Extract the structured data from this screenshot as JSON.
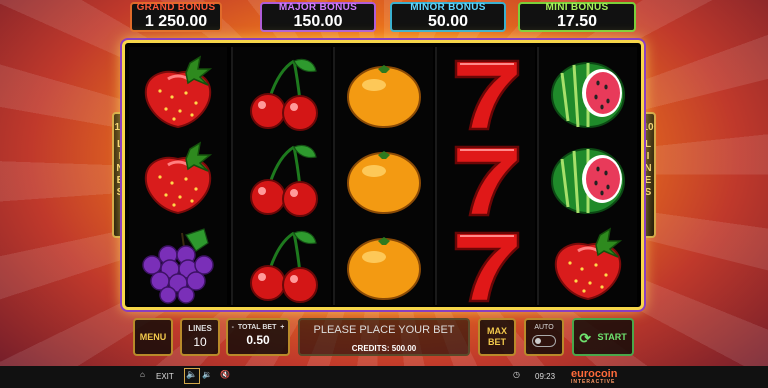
{
  "bonuses": {
    "grand": {
      "label": "GRAND BONUS",
      "value": "1 250.00"
    },
    "major": {
      "label": "MAJOR BONUS",
      "value": "150.00"
    },
    "minor": {
      "label": "MINOR BONUS",
      "value": "50.00"
    },
    "mini": {
      "label": "MINI BONUS",
      "value": "17.50"
    }
  },
  "reels": [
    [
      "strawberry",
      "strawberry",
      "grapes"
    ],
    [
      "cherry",
      "cherry",
      "cherry"
    ],
    [
      "orange",
      "orange",
      "orange"
    ],
    [
      "seven",
      "seven",
      "seven"
    ],
    [
      "watermelon",
      "watermelon",
      "strawberry"
    ]
  ],
  "side_tabs": {
    "number": "10",
    "word": "LINES"
  },
  "controls": {
    "menu_label": "MENU",
    "lines_title": "LINES",
    "lines_value": "10",
    "total_bet_title": "TOTAL BET",
    "total_bet_minus": "-",
    "total_bet_plus": "+",
    "total_bet_value": "0.50",
    "message": "PLEASE PLACE YOUR BET",
    "credits_text": "CREDITS: 500.00",
    "max_bet_label": "MAX BET",
    "auto_label": "AUTO",
    "start_label": "START"
  },
  "footer": {
    "exit_label": "EXIT",
    "time": "09:23",
    "brand": "eurocoin",
    "brand_sub": "INTERACTIVE"
  }
}
